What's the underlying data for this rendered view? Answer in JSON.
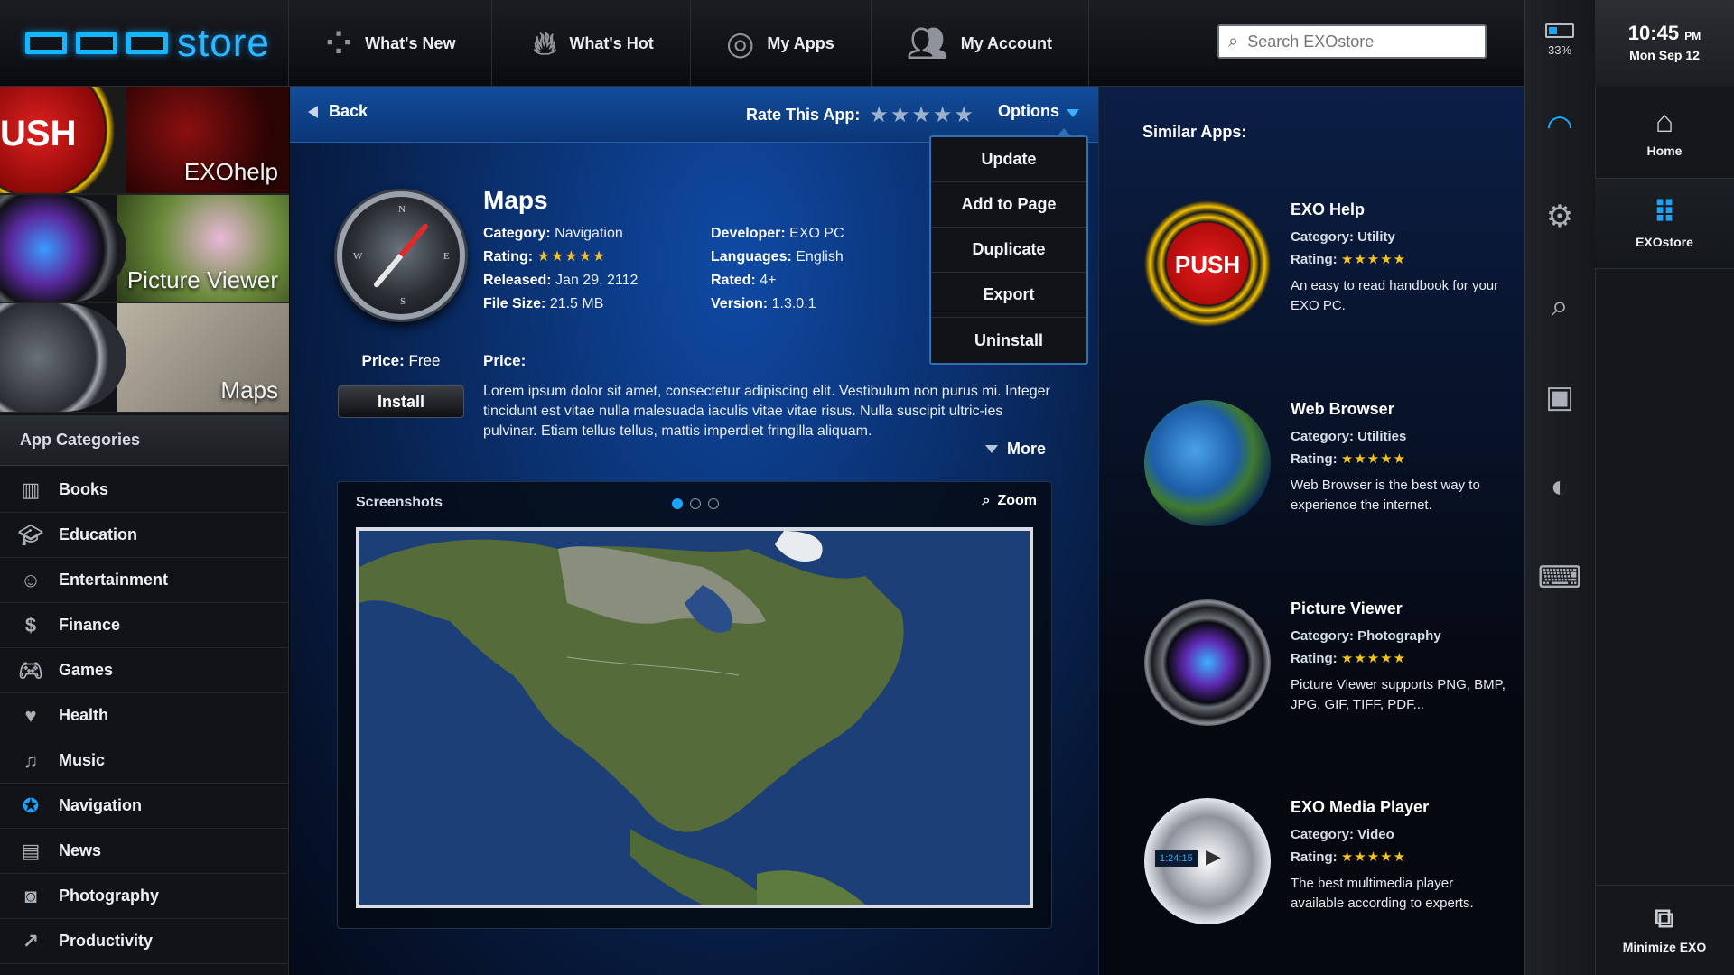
{
  "logo": {
    "text": "store"
  },
  "nav": [
    {
      "label": "What's New",
      "icon": "four-dots-icon"
    },
    {
      "label": "What's Hot",
      "icon": "flame-icon"
    },
    {
      "label": "My Apps",
      "icon": "dotted-circle-icon"
    },
    {
      "label": "My Account",
      "icon": "users-icon"
    }
  ],
  "search": {
    "placeholder": "Search EXOstore",
    "value": ""
  },
  "featured": [
    {
      "label": "EXOhelp",
      "art_text": "USH"
    },
    {
      "label": "Picture Viewer"
    },
    {
      "label": "Maps"
    }
  ],
  "categories": {
    "title": "App Categories",
    "items": [
      {
        "label": "Books"
      },
      {
        "label": "Education"
      },
      {
        "label": "Entertainment"
      },
      {
        "label": "Finance"
      },
      {
        "label": "Games"
      },
      {
        "label": "Health"
      },
      {
        "label": "Music"
      },
      {
        "label": "Navigation"
      },
      {
        "label": "News"
      },
      {
        "label": "Photography"
      },
      {
        "label": "Productivity"
      }
    ]
  },
  "subbar": {
    "back": "Back",
    "rate_label": "Rate This App:",
    "rate_stars": "★★★★★",
    "options": "Options"
  },
  "options_menu": [
    "Update",
    "Add to Page",
    "Duplicate",
    "Export",
    "Uninstall"
  ],
  "app": {
    "name": "Maps",
    "category_label": "Category:",
    "category": "Navigation",
    "rating_label": "Rating:",
    "rating_stars": "★★★★★",
    "released_label": "Released:",
    "released": "Jan 29, 2112",
    "filesize_label": "File Size:",
    "filesize": "21.5 MB",
    "developer_label": "Developer:",
    "developer": "EXO PC",
    "languages_label": "Languages:",
    "languages": "English",
    "rated_label": "Rated:",
    "rated": "4+",
    "version_label": "Version:",
    "version": "1.3.0.1",
    "price_label": "Price:",
    "price": "Free",
    "install": "Install",
    "price_header": "Price:",
    "description": "Lorem ipsum dolor sit amet, consectetur adipiscing elit. Vestibulum non purus mi. Integer tincidunt est vitae nulla malesuada iaculis vitae vitae risus. Nulla suscipit ultric-ies pulvinar. Etiam tellus tellus, mattis imperdiet fringilla aliquam.",
    "more": "More"
  },
  "screenshots": {
    "title": "Screenshots",
    "zoom": "Zoom"
  },
  "similar": {
    "title": "Similar Apps:",
    "apps": [
      {
        "name": "EXO Help",
        "category": "Category: Utility",
        "rating_label": "Rating:",
        "stars": "★★★★★",
        "desc": "An easy to read handbook for your EXO PC.",
        "icon_text": "PUSH"
      },
      {
        "name": "Web Browser",
        "category": "Category: Utilities",
        "rating_label": "Rating:",
        "stars": "★★★★★",
        "desc": "Web Browser is the best way to experience the internet."
      },
      {
        "name": "Picture Viewer",
        "category": "Category: Photography",
        "rating_label": "Rating:",
        "stars": "★★★★★",
        "desc": "Picture Viewer supports PNG, BMP, JPG, GIF, TIFF, PDF..."
      },
      {
        "name": "EXO Media Player",
        "category": "Category: Video",
        "rating_label": "Rating:",
        "stars": "★★★★★",
        "desc": "The best multimedia player available according to experts.",
        "icon_text": "1:24:15"
      }
    ]
  },
  "status": {
    "battery": "33%",
    "time": "10:45",
    "ampm": "PM",
    "date": "Mon Sep 12"
  },
  "side_buttons": {
    "home": "Home",
    "exostore": "EXOstore",
    "minimize": "Minimize EXO"
  },
  "colors": {
    "accent": "#1aa4ff",
    "star": "#f5c320",
    "main_blue": "#0f4aa5"
  }
}
